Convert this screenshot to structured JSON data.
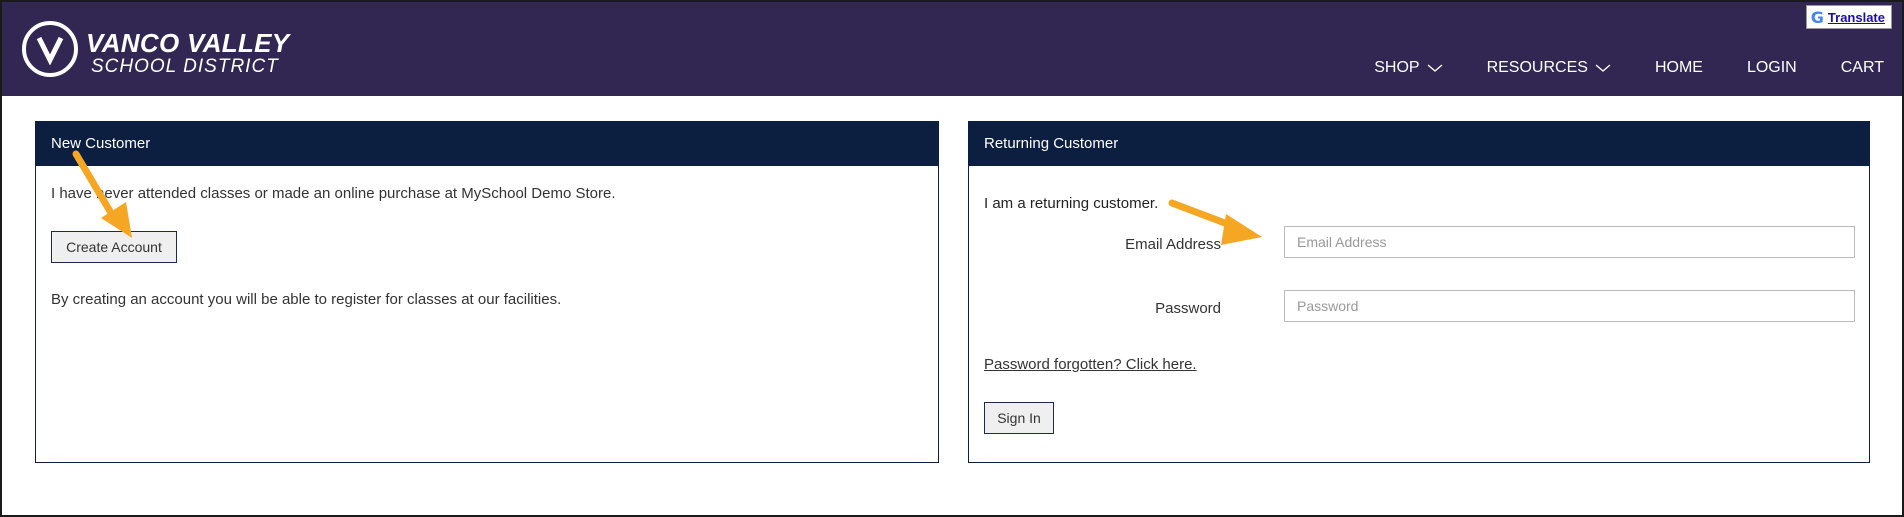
{
  "header": {
    "logo_line1": "VANCO VALLEY",
    "logo_line2": "SCHOOL DISTRICT",
    "translate_label": "Translate",
    "nav": [
      {
        "label": "SHOP",
        "has_dropdown": true
      },
      {
        "label": "RESOURCES",
        "has_dropdown": true
      },
      {
        "label": "HOME",
        "has_dropdown": false
      },
      {
        "label": "LOGIN",
        "has_dropdown": false
      },
      {
        "label": "CART",
        "has_dropdown": false
      }
    ]
  },
  "new_customer": {
    "title": "New Customer",
    "intro": "I have never attended classes or made an online purchase at MySchool Demo Store.",
    "button": "Create Account",
    "note": "By creating an account you will be able to register for classes at our facilities."
  },
  "returning_customer": {
    "title": "Returning Customer",
    "intro": "I am a returning customer.",
    "email_label": "Email Address",
    "email_placeholder": "Email Address",
    "email_value": "",
    "password_label": "Password",
    "password_placeholder": "Password",
    "password_value": "",
    "forgot_link": "Password forgotten? Click here.",
    "sign_in_button": "Sign In"
  },
  "colors": {
    "header_bg": "#322752",
    "panel_head_bg": "#0d1f40",
    "arrow": "#f5a623"
  },
  "icons": [
    "logo-v-icon",
    "google-g-icon",
    "chevron-down-icon",
    "annotation-arrow-icon"
  ]
}
